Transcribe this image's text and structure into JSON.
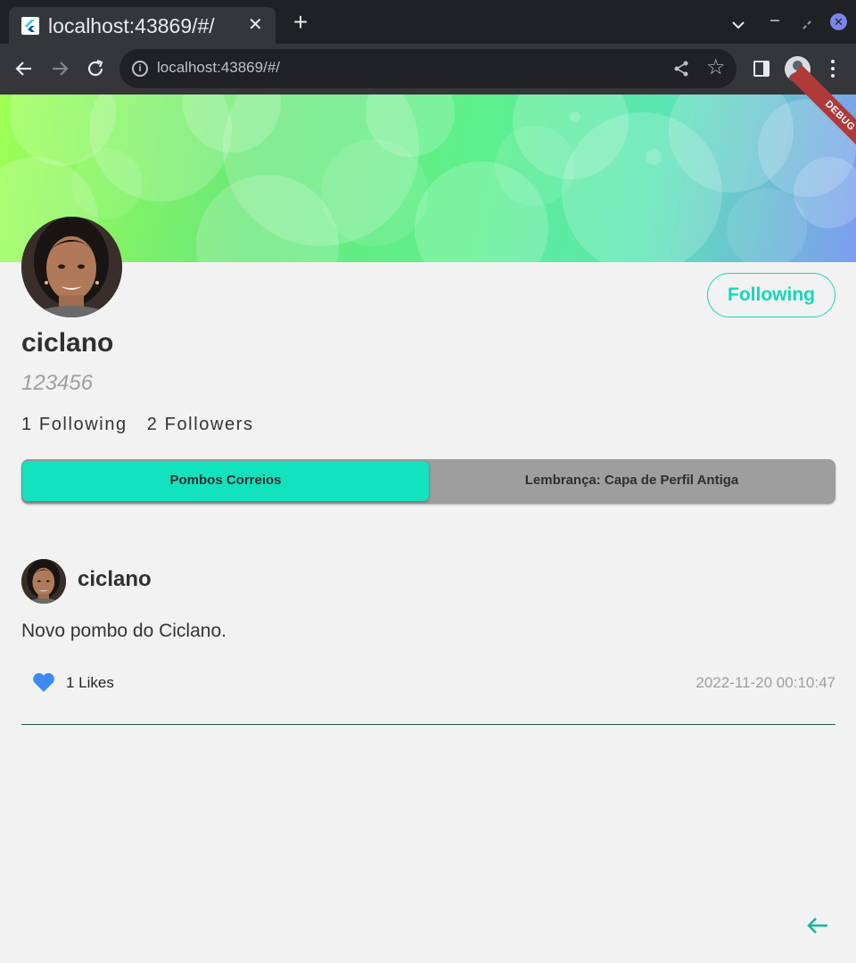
{
  "browser": {
    "tab_title": "localhost:43869/#/",
    "tab_close": "✕",
    "new_tab": "+",
    "url": "localhost:43869/#/",
    "star": "☆",
    "info": "i",
    "win_close": "✕"
  },
  "debug_banner": "DEBUG",
  "profile": {
    "name": "ciclano",
    "handle": "123456",
    "following_label": "1 Following",
    "followers_label": "2 Followers",
    "follow_button": "Following"
  },
  "tabs": [
    {
      "label": "Pombos Correios",
      "active": true
    },
    {
      "label": "Lembrança: Capa de Perfil Antiga",
      "active": false
    }
  ],
  "post": {
    "author": "ciclano",
    "text": "Novo pombo do Ciclano.",
    "likes": "1 Likes",
    "date": "2022-11-20 00:10:47"
  },
  "colors": {
    "accent": "#12e3be",
    "heart": "#3d8bf2",
    "background": "#f2f2f2"
  },
  "icons": {
    "like": "heart-icon",
    "back": "arrow-left-icon"
  }
}
